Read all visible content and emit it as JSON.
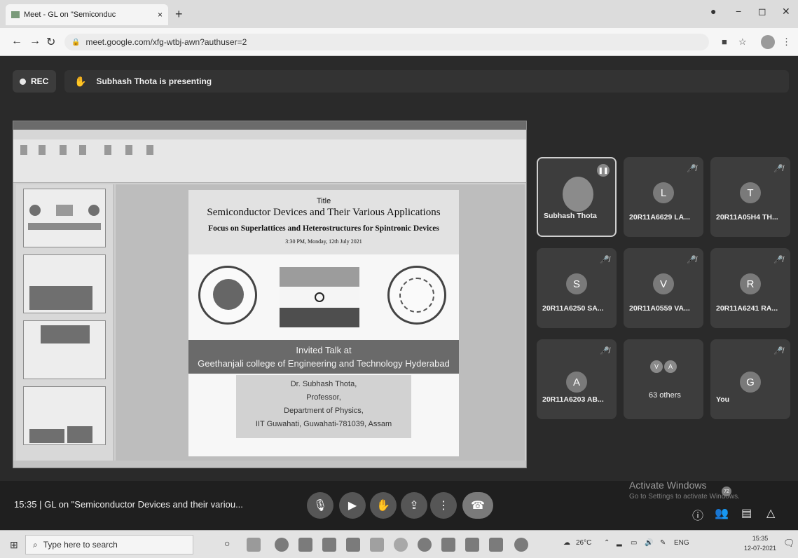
{
  "browser": {
    "tab_title": "Meet - GL on \"Semiconduc",
    "tab_close": "×",
    "new_tab": "+",
    "url": "meet.google.com/xfg-wtbj-awn?authuser=2",
    "min": "−",
    "max": "◻",
    "close": "✕"
  },
  "meet": {
    "rec_label": "REC",
    "presenting_text": "Subhash Thota is presenting"
  },
  "slide": {
    "label": "Title",
    "title": "Semiconductor Devices and Their Various Applications",
    "subtitle": "Focus on Superlattices and Heterostructures for Spintronic Devices",
    "datetime": "3:30 PM, Monday, 12th July 2021",
    "invited_line1": "Invited Talk at",
    "invited_line2": "Geethanjali college of Engineering and Technology Hyderabad",
    "speaker_name": "Dr. Subhash Thota,",
    "speaker_role": "Professor,",
    "speaker_dept": "Department of Physics,",
    "speaker_org": "IIT Guwahati, Guwahati-781039, Assam"
  },
  "participants": [
    {
      "name": "Subhash Thota",
      "initial": "",
      "photo": true
    },
    {
      "name": "20R11A6629 LA...",
      "initial": "L"
    },
    {
      "name": "20R11A05H4 TH...",
      "initial": "T"
    },
    {
      "name": "20R11A6250 SA...",
      "initial": "S"
    },
    {
      "name": "20R11A0559 VA...",
      "initial": "V"
    },
    {
      "name": "20R11A6241 RA...",
      "initial": "R"
    },
    {
      "name": "20R11A6203 AB...",
      "initial": "A"
    },
    {
      "name": "63 others",
      "initial_1": "V",
      "initial_2": "A"
    },
    {
      "name": "You",
      "initial": "G"
    }
  ],
  "bottom_bar": {
    "meeting_info": "15:35  |  GL on \"Semiconductor Devices and their variou...",
    "activate_title": "Activate Windows",
    "activate_sub": "Go to Settings to activate Windows.",
    "chat_badge": "72"
  },
  "taskbar": {
    "search_placeholder": "Type here to search",
    "weather": "26°C",
    "lang": "ENG",
    "time": "15:35",
    "date": "12-07-2021"
  }
}
